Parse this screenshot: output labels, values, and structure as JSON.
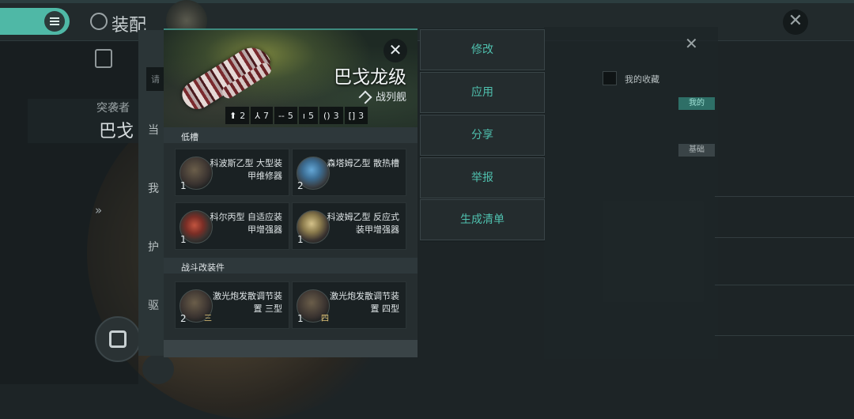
{
  "background": {
    "title": "装配",
    "subtitle_small": "突袭者",
    "subtitle_big": "巴戈",
    "side_labels": [
      "当",
      "我",
      "护",
      "驱"
    ],
    "search_placeholder": "请",
    "favorites_label": "我的收藏",
    "tag_mine": "我的",
    "tag_basic": "基础",
    "chevron": "»"
  },
  "ship": {
    "name": "巴戈龙级",
    "class": "战列舰",
    "stats": [
      {
        "icon": "hardpoint-icon",
        "glyph": "⬆",
        "value": "2"
      },
      {
        "icon": "launcher-icon",
        "glyph": "⅄",
        "value": "7"
      },
      {
        "icon": "high-slot-icon",
        "glyph": "--",
        "value": "5"
      },
      {
        "icon": "mid-slot-icon",
        "glyph": "ı",
        "value": "5"
      },
      {
        "icon": "low-slot-icon",
        "glyph": "()",
        "value": "3"
      },
      {
        "icon": "rig-slot-icon",
        "glyph": "[]",
        "value": "3"
      }
    ]
  },
  "sections": {
    "low_slots": {
      "title": "低槽",
      "items": [
        {
          "name": "科波斯乙型 大型装甲维修器",
          "count": "1",
          "tier": "",
          "icon": "armor-repairer-icon"
        },
        {
          "name": "森塔姆乙型 散热槽",
          "count": "2",
          "tier": "",
          "icon": "heat-sink-icon"
        },
        {
          "name": "科尔丙型 自适应装甲增强器",
          "count": "1",
          "tier": "",
          "icon": "adaptive-hardener-icon"
        },
        {
          "name": "科波姆乙型 反应式装甲增强器",
          "count": "1",
          "tier": "",
          "icon": "reactive-hardener-icon"
        }
      ]
    },
    "rigs": {
      "title": "战斗改装件",
      "items": [
        {
          "name": "激光炮发散调节装置 三型",
          "count": "2",
          "tier": "三",
          "icon": "laser-rig-icon"
        },
        {
          "name": "激光炮发散调节装置 四型",
          "count": "1",
          "tier": "四",
          "icon": "laser-rig-icon"
        }
      ]
    }
  },
  "actions": [
    "修改",
    "应用",
    "分享",
    "举报",
    "生成清单"
  ],
  "colors": {
    "accent": "#4fc0ae",
    "panel": "#262e30",
    "card": "#1a2123"
  }
}
